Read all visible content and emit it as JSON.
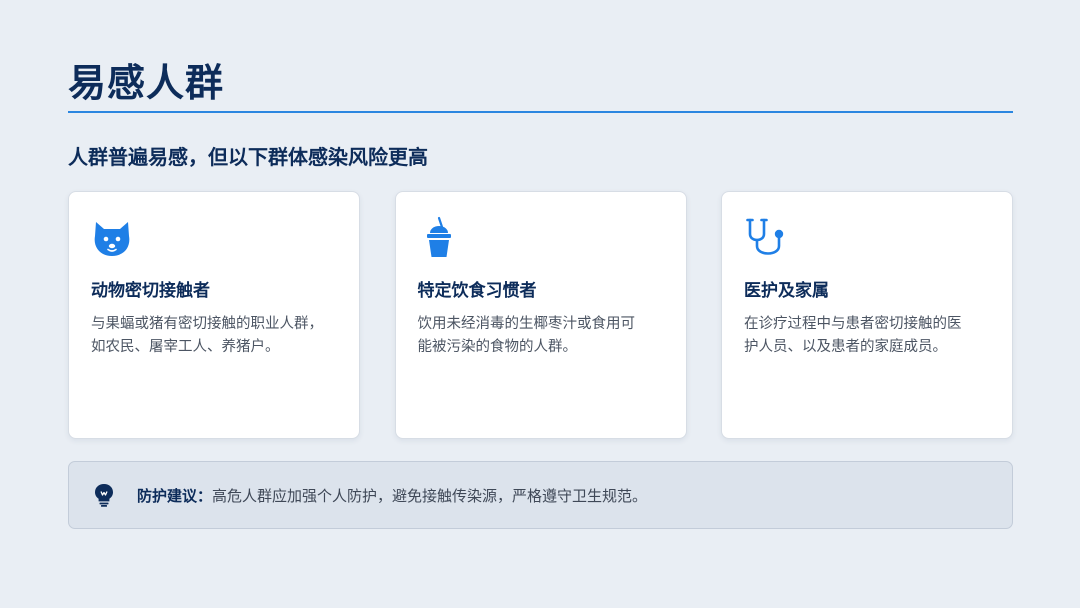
{
  "header": {
    "title": "易感人群"
  },
  "subtitle": "人群普遍易感，但以下群体感染风险更高",
  "cards": [
    {
      "icon": "dog-face-icon",
      "title": "动物密切接触者",
      "desc_line1": "与果蝠或猪有密切接触的职业人群，",
      "desc_line2": "如农民、屠宰工人、养猪户。"
    },
    {
      "icon": "drink-cup-icon",
      "title": "特定饮食习惯者",
      "desc_line1": "饮用未经消毒的生椰枣汁或食用可",
      "desc_line2": "能被污染的食物的人群。"
    },
    {
      "icon": "stethoscope-icon",
      "title": "医护及家属",
      "desc_line1": "在诊疗过程中与患者密切接触的医",
      "desc_line2": "护人员、以及患者的家庭成员。"
    }
  ],
  "tip": {
    "icon": "lightbulb-icon",
    "label": "防护建议：",
    "text": "高危人群应加强个人防护，避免接触传染源，严格遵守卫生规范。"
  },
  "colors": {
    "background": "#e9eef4",
    "heading": "#0d2c5a",
    "accent": "#2b86e0",
    "icon_blue": "#1f7fe6",
    "tip_background": "#dce3ec"
  }
}
